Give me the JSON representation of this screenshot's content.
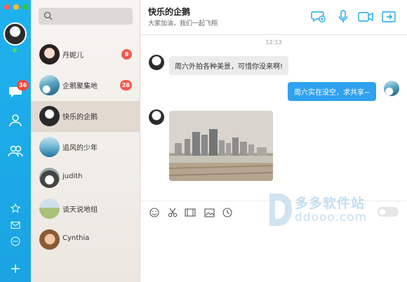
{
  "window": {
    "traffic_lights": [
      "close",
      "minimize",
      "zoom"
    ]
  },
  "rail": {
    "unread_badge": "36",
    "icons": [
      "chat-icon",
      "contact-icon",
      "group-icon",
      "star-icon",
      "mail-icon",
      "more-icon",
      "add-icon"
    ],
    "accent": "#1fb2ee"
  },
  "search": {
    "placeholder": ""
  },
  "contacts": [
    {
      "name": "丹妮儿",
      "badge": "8"
    },
    {
      "name": "企鹅聚集地",
      "badge": "28"
    },
    {
      "name": "快乐的企鹅",
      "badge": ""
    },
    {
      "name": "追风的少年",
      "badge": ""
    },
    {
      "name": "judith",
      "badge": ""
    },
    {
      "name": "谈天说地组",
      "badge": ""
    },
    {
      "name": "Cynthia",
      "badge": ""
    }
  ],
  "chat": {
    "title": "快乐的企鹅",
    "subtitle": "大家加油，我们一起飞翔",
    "timestamp": "12:13",
    "messages": [
      {
        "direction": "in",
        "text": "周六外拍各种美景，可惜你没来啊!"
      },
      {
        "direction": "out",
        "text": "周六实在没空，求共享~"
      },
      {
        "direction": "in",
        "type": "image"
      }
    ],
    "header_icons": [
      "add-chat-icon",
      "microphone-icon",
      "video-icon",
      "share-icon"
    ],
    "toolbar_icons": [
      "emoji-icon",
      "scissors-icon",
      "film-icon",
      "image-icon",
      "clock-icon"
    ],
    "bubble_out_color": "#2fa1f1"
  },
  "watermark": {
    "brand": "多多软件站",
    "url": "ddooo.com"
  }
}
